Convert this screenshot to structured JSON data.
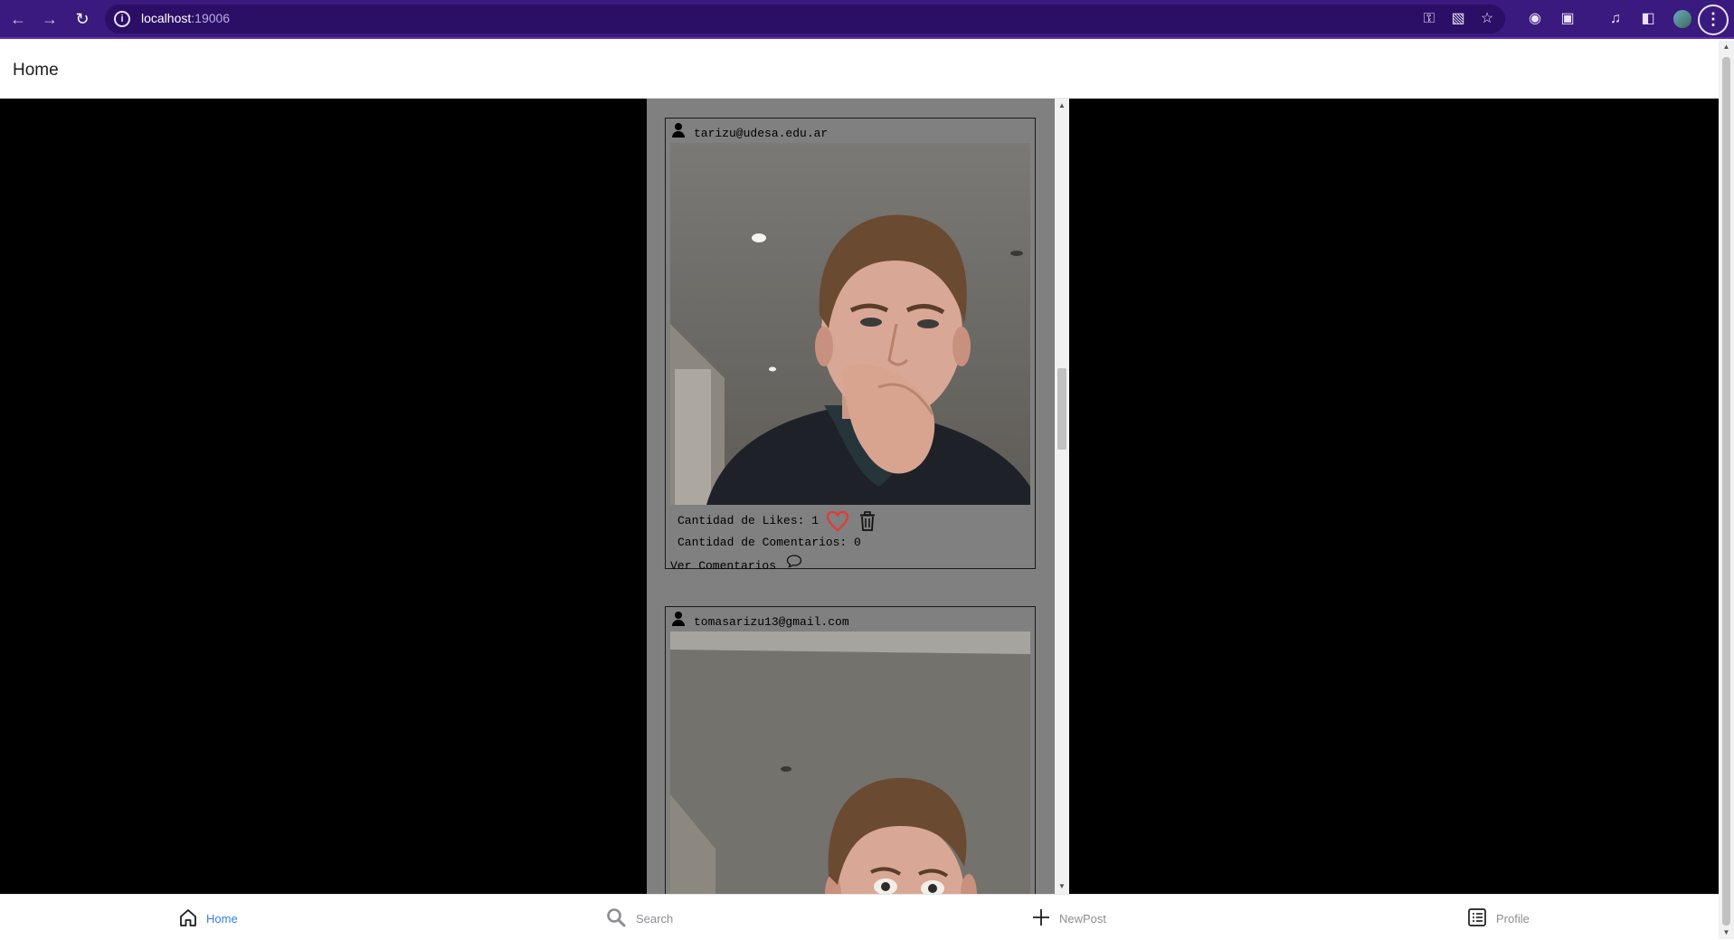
{
  "browser": {
    "url_host": "localhost",
    "url_port": ":19006"
  },
  "header": {
    "title": "Home"
  },
  "posts": [
    {
      "user": "tarizu@udesa.edu.ar",
      "likes_label": "Cantidad de Likes: 1",
      "comments_label": "Cantidad de Comentarios: 0",
      "view_comments_label": "Ver Comentarios",
      "liked": true
    },
    {
      "user": "tomasarizu13@gmail.com"
    }
  ],
  "tabs": [
    {
      "label": "Home",
      "icon": "home-icon",
      "active": true
    },
    {
      "label": "Search",
      "icon": "search-icon",
      "active": false
    },
    {
      "label": "NewPost",
      "icon": "plus-icon",
      "active": false
    },
    {
      "label": "Profile",
      "icon": "list-icon",
      "active": false
    }
  ],
  "colors": {
    "browser_frame": "#3a1a7e",
    "content_bg": "#000000",
    "feed_bg": "#808080",
    "active_tab": "#2f80ed",
    "heart": "#e53935"
  }
}
